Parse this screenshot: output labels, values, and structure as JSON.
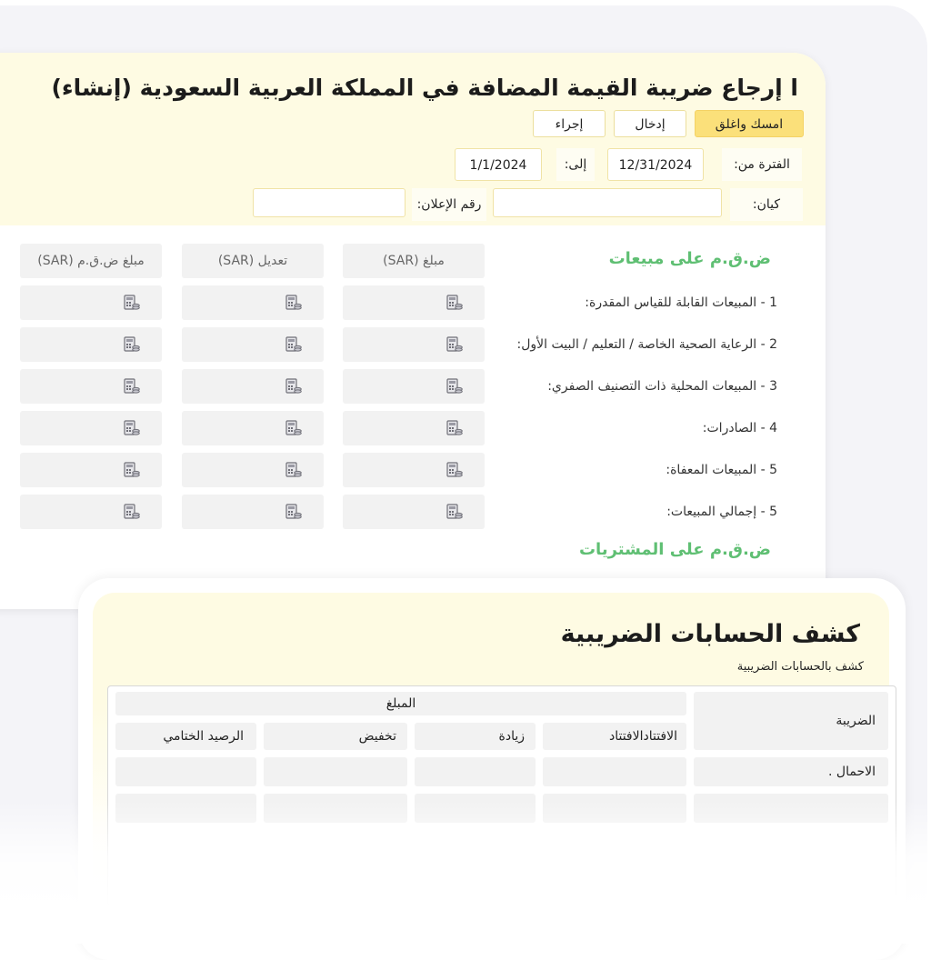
{
  "vat_return": {
    "title": "ا إرجاع ضريبة القيمة المضافة في المملكة العربية السعودية (إنشاء)",
    "buttons": {
      "save_close": "امسك واغلق",
      "entry": "إدخال",
      "action": "إجراء"
    },
    "period_from_label": "الفترة من:",
    "period_from_value": "12/31/2024",
    "period_to_label": "إلى:",
    "period_to_value": "1/1/2024",
    "entity_label": "كيان:",
    "entity_value": "",
    "declaration_label": "رقم الإعلان:",
    "declaration_value": "",
    "sales_section_title": "ض.ق.م على مبيعات",
    "purchases_section_title": "ض.ق.م على المشتريات",
    "columns": {
      "amount": "مبلغ (SAR)",
      "adjustment": "تعديل (SAR)",
      "vat_amount": "مبلغ ض.ق.م (SAR)"
    },
    "rows": [
      "1 - المبيعات القابلة للقياس المقدرة:",
      "2 - الرعاية الصحية الخاصة / التعليم / البيت الأول:",
      "3 - المبيعات المحلية ذات التصنيف الصفري:",
      "4 - الصادرات:",
      "5 - المبيعات المعفاة:",
      "5 - إجمالي المبيعات:"
    ]
  },
  "tax_statement": {
    "title": "كشف الحسابات الضريبية",
    "subtitle": "كشف بالحسابات الضريبية",
    "headers": {
      "tax": "الضريبة",
      "amount": "المبلغ",
      "opening": "الافتتادالافتتاد",
      "increase": "زيادة",
      "decrease": "تخفيض",
      "closing": "الرصيد الختامي"
    },
    "rows": [
      "الاحمال ."
    ]
  },
  "colors": {
    "header_bg": "#fefbe3",
    "primary_button": "#fbe07a",
    "section_green": "#5fbf73",
    "cell_gray": "#f2f2f2"
  },
  "icons": {
    "cell_icon": "calculator-icon"
  }
}
